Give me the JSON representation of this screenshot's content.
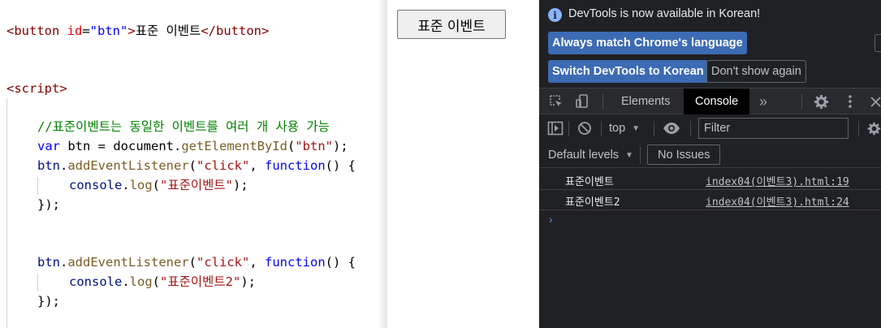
{
  "editor": {
    "line1": {
      "open_tag": "<button",
      "attr_name": " id",
      "eq": "=",
      "attr_val": "\"btn\"",
      "close_open": ">",
      "text": "표준 이벤트",
      "close_tag": "</button>"
    },
    "line2": {
      "script_tag": "<script>"
    },
    "comment": "//표준이벤트는 동일한 이벤트를 여러 개 사용 가능",
    "var_line": {
      "kw": "var",
      "name": " btn = ",
      "obj": "document",
      "dot": ".",
      "method": "getElementById",
      "open": "(",
      "arg": "\"btn\"",
      "close": ");"
    },
    "listener1": {
      "obj": "btn",
      "dot": ".",
      "method": "addEventListener",
      "open": "(",
      "arg": "\"click\"",
      "comma": ", ",
      "kw": "function",
      "rest": "() {"
    },
    "log1": {
      "obj": "console",
      "dot": ".",
      "method": "log",
      "open": "(",
      "arg": "\"표준이벤트\"",
      "close": ");"
    },
    "end1": "});",
    "listener2": {
      "obj": "btn",
      "dot": ".",
      "method": "addEventListener",
      "open": "(",
      "arg": "\"click\"",
      "comma": ", ",
      "kw": "function",
      "rest": "() {"
    },
    "log2": {
      "obj": "console",
      "dot": ".",
      "method": "log",
      "open": "(",
      "arg": "\"표준이벤트2\"",
      "close": ");"
    },
    "end2": "});"
  },
  "preview": {
    "button_label": "표준 이벤트"
  },
  "devtools": {
    "info_icon": "i",
    "info_text": "DevTools is now available in Korean!",
    "match_language_button": "Always match Chrome's language",
    "switch_korean_button": "Switch DevTools to Korean",
    "dont_show_button": "Don't show again",
    "tabs": [
      {
        "label": "Elements",
        "active": false
      },
      {
        "label": "Console",
        "active": true
      }
    ],
    "context_select": "top",
    "filter_placeholder": "Filter",
    "default_levels": "Default levels",
    "no_issues": "No Issues",
    "messages": [
      {
        "text": "표준이벤트",
        "source": "index04(이벤트3).html:19"
      },
      {
        "text": "표준이벤트2",
        "source": "index04(이벤트3).html:24"
      }
    ],
    "prompt_symbol": "›",
    "accent_color": "#3c6bb4",
    "icons": [
      "inspect-element-icon",
      "device-toolbar-icon",
      "more-tabs-icon",
      "settings-gear-icon",
      "kebab-menu-icon",
      "close-icon",
      "sidebar-toggle-icon",
      "clear-console-icon",
      "dropdown-arrow-icon",
      "eye-icon",
      "console-settings-gear-icon"
    ]
  }
}
